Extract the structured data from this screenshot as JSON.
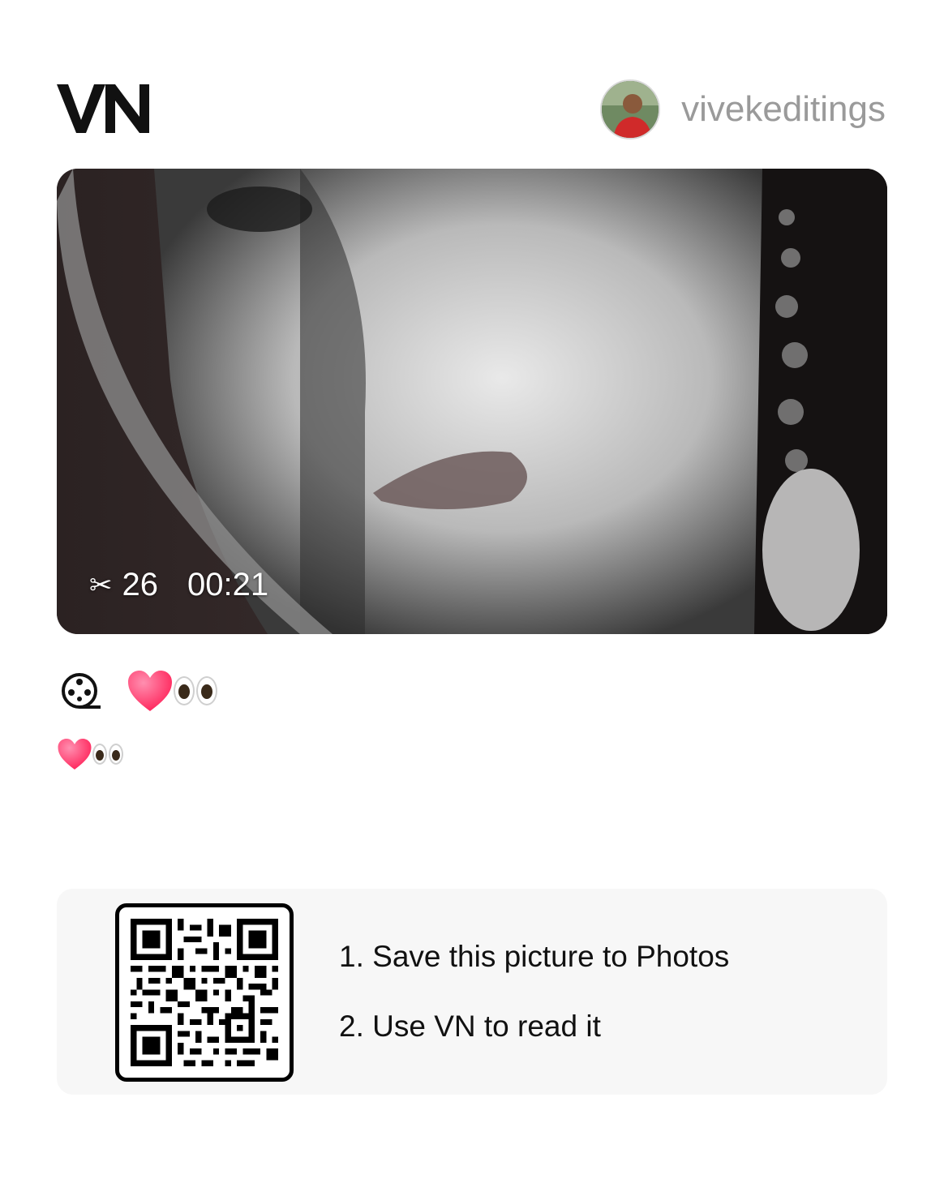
{
  "header": {
    "logo_text": "VN",
    "username": "vivekeditings",
    "avatar_icon": "user-avatar"
  },
  "video": {
    "clips_icon": "scissors-icon",
    "clips_count": "26",
    "duration": "00:21"
  },
  "caption": {
    "template_icon": "film-reel-icon",
    "emoji": "heart-eyes"
  },
  "description": {
    "emoji": "heart-eyes"
  },
  "qr": {
    "icon": "qr-code",
    "step1": "1. Save this picture to Photos",
    "step2": "2. Use VN to read it"
  },
  "colors": {
    "background": "#ffffff",
    "username": "#9a9a9a",
    "heart": "#ff3d72",
    "card": "#f7f7f7"
  }
}
